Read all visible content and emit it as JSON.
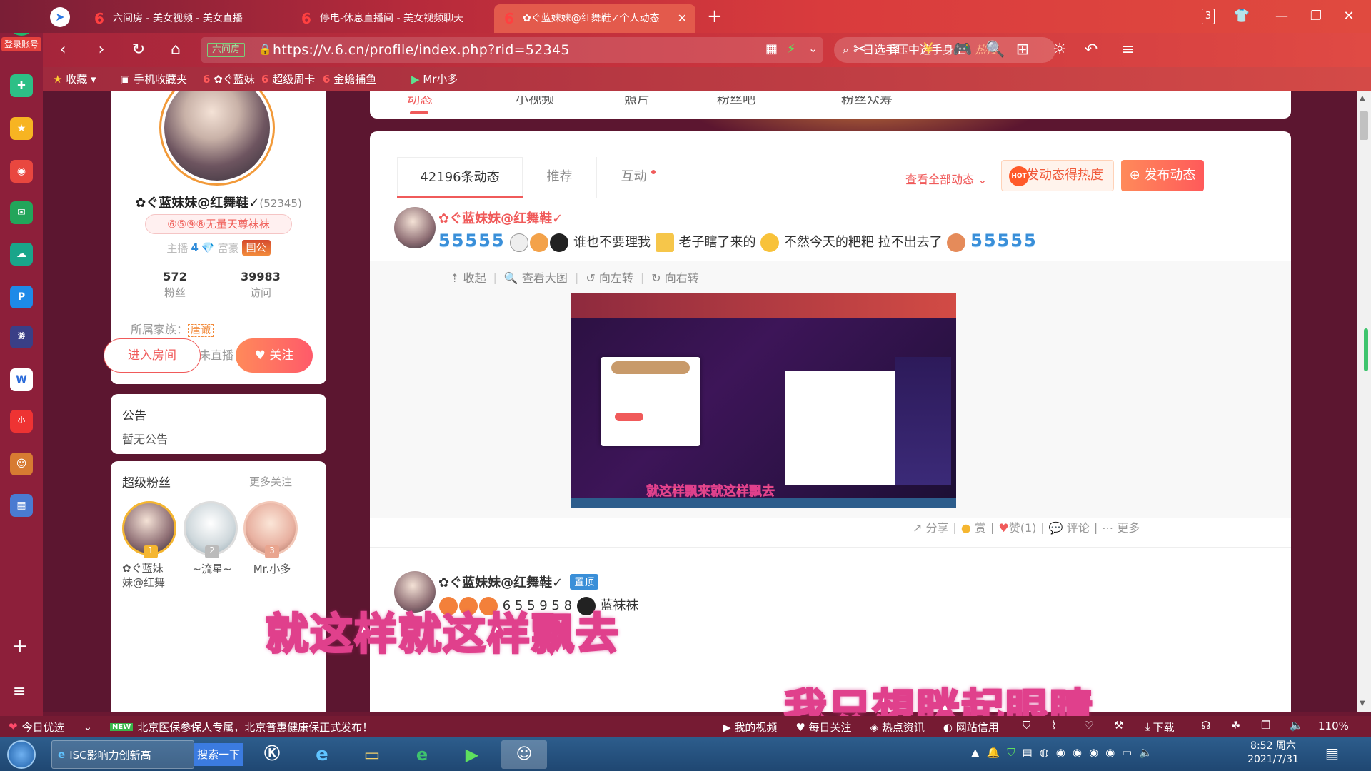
{
  "browser": {
    "tabs": [
      {
        "title": "六间房 - 美女视频 - 美女直播"
      },
      {
        "title": "停电-休息直播间 - 美女视频聊天"
      },
      {
        "title": "✿ぐ蓝妹妹@红舞鞋✓个人动态"
      }
    ],
    "tab_count": "3",
    "address_tag": "六间房",
    "url": "https://v.6.cn/profile/index.php?rid=52345",
    "search_text": "日选手压中选手身上",
    "search_hot": "热搜",
    "login_label": "登录账号"
  },
  "bookmarks": [
    {
      "label": "收藏"
    },
    {
      "label": "手机收藏夹"
    },
    {
      "label": "✿ぐ蓝妹"
    },
    {
      "label": "超级周卡"
    },
    {
      "label": "金蟾捕鱼"
    },
    {
      "label": "Mr小多"
    }
  ],
  "profile": {
    "name": "✿ぐ蓝妹妹@红舞鞋✓",
    "rid": "(52345)",
    "tag": "⑥⑤⑨⑧无量天尊袜袜",
    "role_label": "主播",
    "role_level": "4",
    "rich_label": "富豪",
    "rich_badge": "国公",
    "fans_count": "572",
    "fans_label": "粉丝",
    "visit_count": "39983",
    "visit_label": "访问",
    "family_label": "所属家族：",
    "family_badge": "唐诚",
    "last_live": "上次直播：从未直播",
    "enter_room": "进入房间",
    "follow": "关注"
  },
  "notice": {
    "title": "公告",
    "text": "暂无公告"
  },
  "superfans": {
    "title": "超级粉丝",
    "more": "更多关注",
    "fans": [
      {
        "rank": "1",
        "name": "✿ぐ蓝妹妹@红舞"
      },
      {
        "rank": "2",
        "name": "~流星~"
      },
      {
        "rank": "3",
        "name": "Mr.小多"
      }
    ]
  },
  "top_tabs": [
    "动态",
    "小视频",
    "照片",
    "粉丝吧",
    "粉丝众筹"
  ],
  "feed": {
    "tabs": [
      "42196条动态",
      "推荐",
      "互动"
    ],
    "view_all": "查看全部动态",
    "hot_btn": "发动态得热度",
    "post_btn": "发布动态",
    "post1": {
      "author": "✿ぐ蓝妹妹@红舞鞋✓",
      "text_a": "谁也不要理我",
      "text_b": "老子瞎了来的",
      "text_c": "不然今天的粑粑 拉不出去了",
      "tools": [
        "收起",
        "查看大图",
        "向左转",
        "向右转"
      ],
      "image_caption": "就这样飘来就这样飘去",
      "actions": {
        "share": "分享",
        "reward": "赏",
        "like": "赞(1)",
        "comment": "评论",
        "more": "更多"
      }
    },
    "post2": {
      "author": "✿ぐ蓝妹妹@红舞鞋✓",
      "pin": "置顶",
      "text": "6 5 5 9 5 8",
      "text2": "蓝袜袜"
    }
  },
  "subtitles": {
    "line1": "就这样就这样飘去",
    "line2": "我只想眯起眼睛"
  },
  "status": {
    "news_label": "今日优选",
    "news_badge": "NEW",
    "news_text": "北京医保参保人专属，北京普惠健康保正式发布！",
    "items": [
      "我的视频",
      "每日关注",
      "热点资讯",
      "网站信用"
    ],
    "download": "下载",
    "zoom": "110%"
  },
  "taskbar": {
    "app1": "ISC影响力创新高",
    "search_btn": "搜索一下",
    "time": "8:52 周六",
    "date": "2021/7/31"
  }
}
